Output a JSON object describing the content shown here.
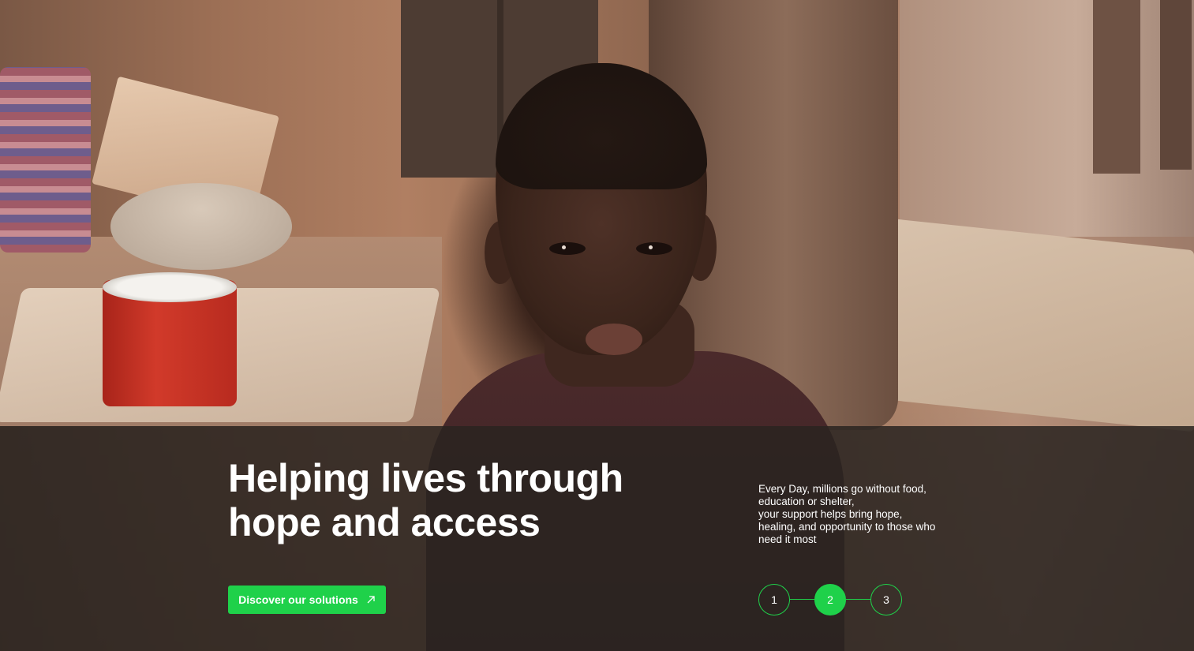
{
  "hero": {
    "image": "hero-photo-child",
    "title_line1": "Helping lives through",
    "title_line2": "hope and access",
    "cta_label": "Discover our solutions",
    "cta_icon": "arrow-up-right-icon",
    "description_lines": [
      "Every Day, millions go without food,",
      "education or shelter,",
      "your support helps bring hope,",
      "healing, and opportunity to those who",
      "need it most"
    ]
  },
  "pager": {
    "pages": [
      "1",
      "2",
      "3"
    ],
    "active": "2"
  },
  "colors": {
    "accent": "#1fd14a",
    "overlay": "#2a2421",
    "text": "#ffffff"
  }
}
